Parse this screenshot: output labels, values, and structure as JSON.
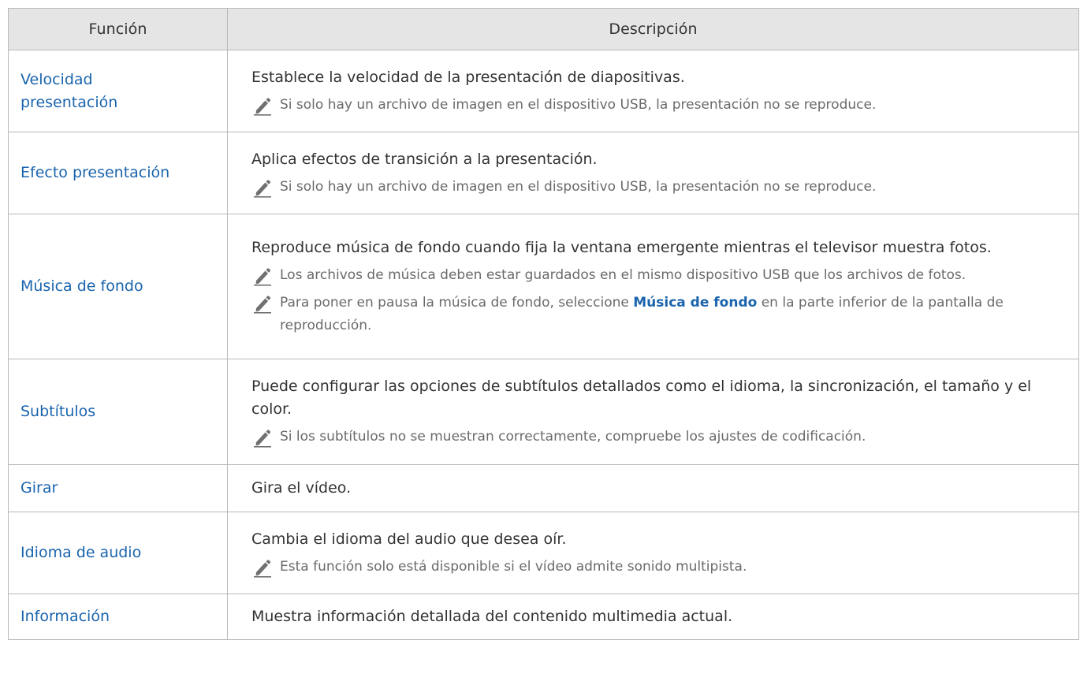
{
  "table": {
    "headers": {
      "col1": "Función",
      "col2": "Descripción"
    },
    "rows": [
      {
        "name_line1": "Velocidad",
        "name_line2": "presentación",
        "description": "Establece la velocidad de la presentación de diapositivas.",
        "notes": [
          "Si solo hay un archivo de imagen en el dispositivo USB, la presentación no se reproduce."
        ]
      },
      {
        "name": "Efecto presentación",
        "description": "Aplica efectos de transición a la presentación.",
        "notes": [
          "Si solo hay un archivo de imagen en el dispositivo USB, la presentación no se reproduce."
        ]
      },
      {
        "name": "Música de fondo",
        "description": "Reproduce música de fondo cuando fija la ventana emergente mientras el televisor muestra fotos.",
        "notes": [
          "Los archivos de música deben estar guardados en el mismo dispositivo USB que los archivos de fotos."
        ],
        "note2_before": "Para poner en pausa la música de fondo, seleccione ",
        "note2_highlight": "Música de fondo",
        "note2_after": " en la parte inferior de la pantalla de reproducción."
      },
      {
        "name": "Subtítulos",
        "description": "Puede configurar las opciones de subtítulos detallados como el idioma, la sincronización, el tamaño y el color.",
        "notes": [
          "Si los subtítulos no se muestran correctamente, compruebe los ajustes de codificación."
        ]
      },
      {
        "name": "Girar",
        "description": "Gira el vídeo."
      },
      {
        "name": "Idioma de audio",
        "description": "Cambia el idioma del audio que desea oír.",
        "notes": [
          "Esta función solo está disponible si el vídeo admite sonido multipista."
        ]
      },
      {
        "name": "Información",
        "description": "Muestra información detallada del contenido multimedia actual."
      }
    ]
  },
  "icons": {
    "note": "pencil-icon"
  },
  "colors": {
    "link": "#1a64ad",
    "header_bg": "#e5e5e5",
    "border": "#b9b9b9",
    "note_text": "#6a6a6a",
    "body_text": "#333333"
  }
}
